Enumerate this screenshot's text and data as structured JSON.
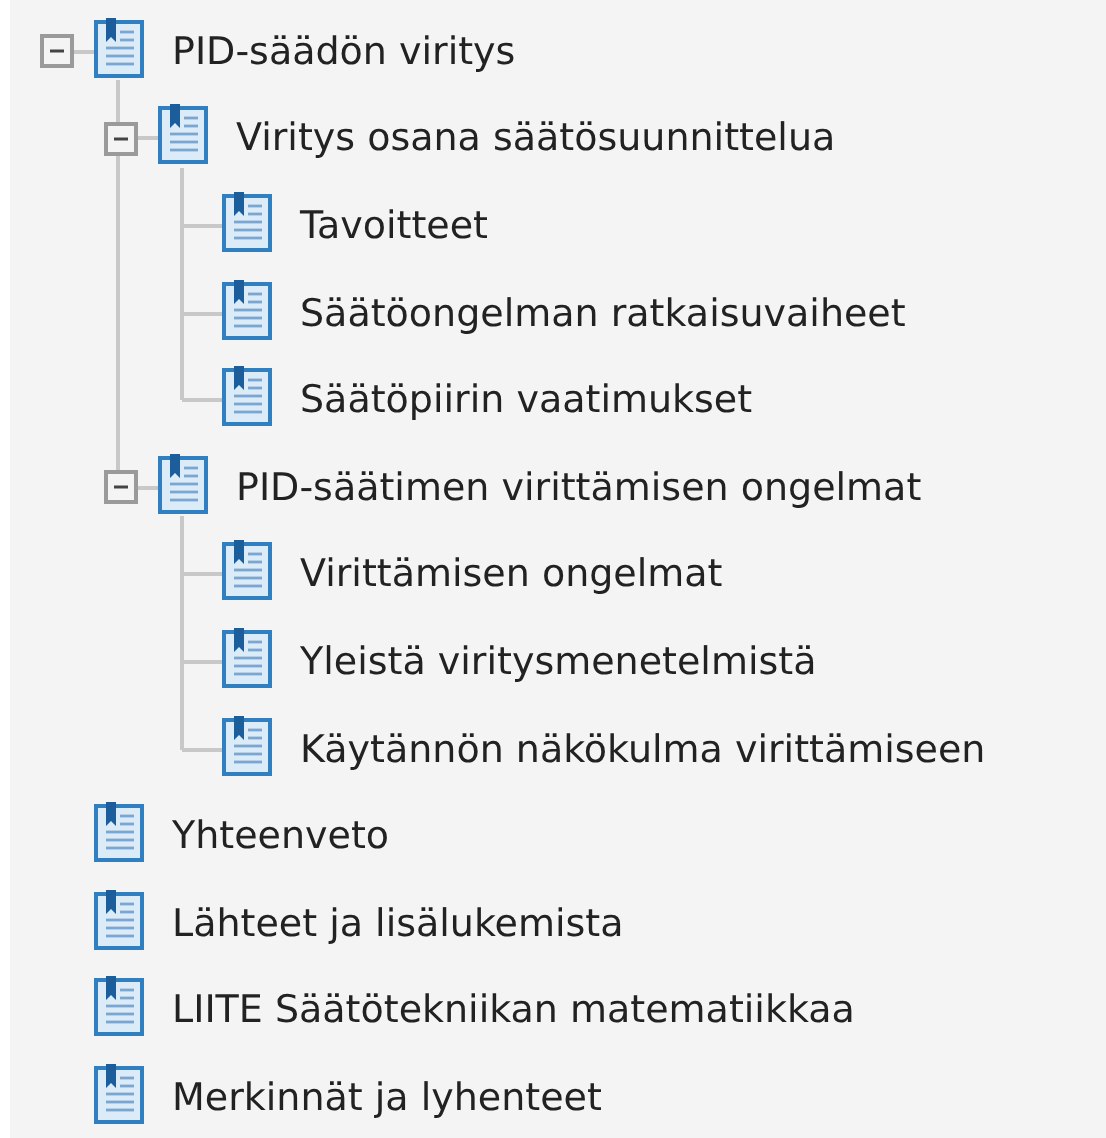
{
  "tree": [
    {
      "label": "PID-säädön viritys",
      "expanded": true,
      "children": [
        {
          "label": "Viritys osana säätösuunnittelua",
          "expanded": true,
          "children": [
            {
              "label": "Tavoitteet"
            },
            {
              "label": "Säätöongelman ratkaisuvaiheet"
            },
            {
              "label": "Säätöpiirin vaatimukset"
            }
          ]
        },
        {
          "label": "PID-säätimen virittämisen ongelmat",
          "expanded": true,
          "children": [
            {
              "label": "Virittämisen ongelmat"
            },
            {
              "label": "Yleistä viritysmenetelmistä"
            },
            {
              "label": "Käytännön näkökulma virittämiseen"
            }
          ]
        }
      ]
    },
    {
      "label": "Yhteenveto"
    },
    {
      "label": "Lähteet ja lisälukemista"
    },
    {
      "label": "LIITE Säätötekniikan matematiikkaa"
    },
    {
      "label": "Merkinnät ja lyhenteet"
    }
  ]
}
